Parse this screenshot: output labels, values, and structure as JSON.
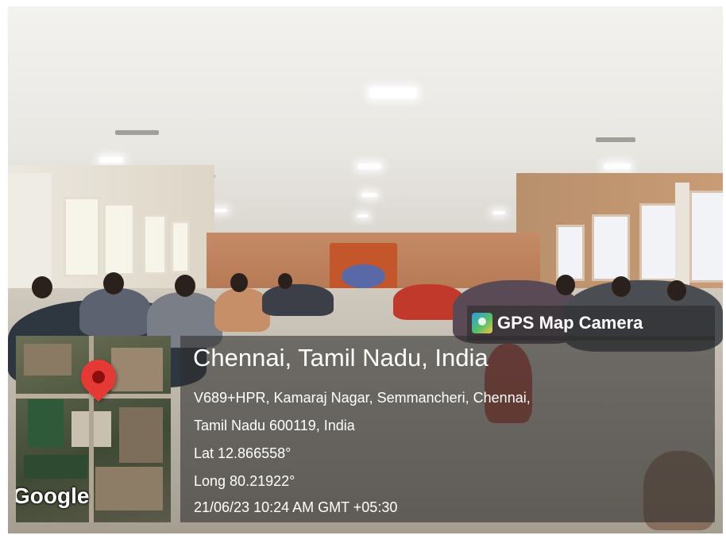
{
  "badge": {
    "label": "GPS Map Camera",
    "icon": "gps-map-camera-icon"
  },
  "map": {
    "attribution": "Google",
    "pin_icon": "location-pin-icon"
  },
  "location": {
    "title": "Chennai, Tamil Nadu, India",
    "address_line1": "V689+HPR, Kamaraj Nagar, Semmancheri, Chennai,",
    "address_line2": "Tamil Nadu 600119, India",
    "latitude": "Lat 12.866558°",
    "longitude": "Long 80.21922°",
    "timestamp": "21/06/23 10:24 AM GMT +05:30"
  },
  "colors": {
    "pin": "#e53935",
    "panel": "#2d2d2d"
  }
}
